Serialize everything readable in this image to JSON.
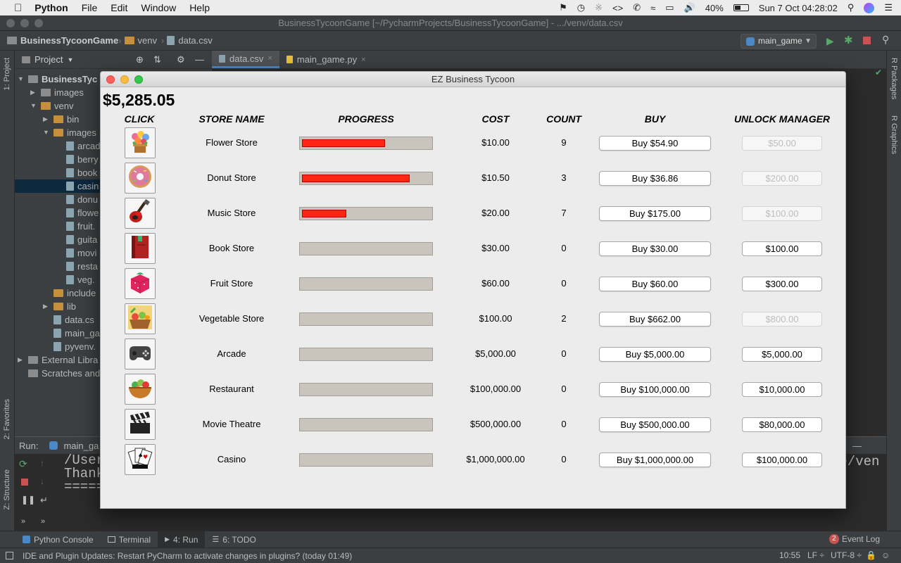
{
  "menubar": {
    "app": "Python",
    "items": [
      "File",
      "Edit",
      "Window",
      "Help"
    ],
    "battery": "40%",
    "clock": "Sun 7 Oct  04:28:02"
  },
  "ide": {
    "title": "BusinessTycoonGame [~/PycharmProjects/BusinessTycoonGame] - .../venv/data.csv",
    "breadcrumb": [
      "BusinessTycoonGame",
      "venv",
      "data.csv"
    ],
    "run_config": "main_game",
    "project_label": "Project",
    "tabs": [
      "data.csv",
      "main_game.py"
    ],
    "left_tools": [
      "1: Project",
      "2: Favorites",
      "Z: Structure"
    ],
    "right_tools": [
      "R Packages",
      "R Graphics"
    ],
    "tree": [
      {
        "label": "BusinessTyc",
        "indent": 0,
        "kind": "folder",
        "open": true,
        "bold": true
      },
      {
        "label": "images",
        "indent": 1,
        "kind": "folder",
        "open": false
      },
      {
        "label": "venv",
        "indent": 1,
        "kind": "folder-orange",
        "open": true
      },
      {
        "label": "bin",
        "indent": 2,
        "kind": "folder-orange",
        "open": false
      },
      {
        "label": "images",
        "indent": 2,
        "kind": "folder-orange",
        "open": true
      },
      {
        "label": "arcad",
        "indent": 3,
        "kind": "file"
      },
      {
        "label": "berry",
        "indent": 3,
        "kind": "file"
      },
      {
        "label": "book",
        "indent": 3,
        "kind": "file"
      },
      {
        "label": "casin",
        "indent": 3,
        "kind": "file",
        "selected": true
      },
      {
        "label": "donu",
        "indent": 3,
        "kind": "file"
      },
      {
        "label": "flowe",
        "indent": 3,
        "kind": "file"
      },
      {
        "label": "fruit.",
        "indent": 3,
        "kind": "file"
      },
      {
        "label": "guita",
        "indent": 3,
        "kind": "file"
      },
      {
        "label": "movi",
        "indent": 3,
        "kind": "file"
      },
      {
        "label": "resta",
        "indent": 3,
        "kind": "file"
      },
      {
        "label": "veg.",
        "indent": 3,
        "kind": "file"
      },
      {
        "label": "include",
        "indent": 2,
        "kind": "folder-orange",
        "open": false,
        "noarrow": true
      },
      {
        "label": "lib",
        "indent": 2,
        "kind": "folder-orange",
        "open": false
      },
      {
        "label": "data.cs",
        "indent": 2,
        "kind": "file"
      },
      {
        "label": "main_ga",
        "indent": 2,
        "kind": "file"
      },
      {
        "label": "pyvenv.",
        "indent": 2,
        "kind": "file"
      },
      {
        "label": "External Libra",
        "indent": 0,
        "kind": "folder",
        "open": false
      },
      {
        "label": "Scratches and",
        "indent": 0,
        "kind": "folder",
        "noarrow": true
      }
    ],
    "run": {
      "label": "Run:",
      "tab": "main_ga",
      "lines": [
        "/User",
        "Thank",
        "====="
      ],
      "right_fragment": "me/ven"
    },
    "bottom_tabs": [
      "Python Console",
      "Terminal",
      "4: Run",
      "6: TODO"
    ],
    "event_log": "Event Log",
    "event_count": "2",
    "status_message": "IDE and Plugin Updates: Restart PyCharm to activate changes in plugins? (today 01:49)",
    "cursor": "10:55",
    "line_sep": "LF ÷",
    "encoding": "UTF-8 ÷"
  },
  "game": {
    "window_title": "EZ Business Tycoon",
    "money": "$5,285.05",
    "headers": {
      "click": "CLICK",
      "store": "STORE NAME",
      "progress": "PROGRESS",
      "cost": "COST",
      "count": "COUNT",
      "buy": "BUY",
      "manager": "UNLOCK MANAGER"
    },
    "stores": [
      {
        "icon": "flower-pot-icon",
        "name": "Flower Store",
        "progress": 0.64,
        "cost": "$10.00",
        "count": "9",
        "buy": "Buy $54.90",
        "manager": "$50.00",
        "manager_enabled": false
      },
      {
        "icon": "donut-icon",
        "name": "Donut Store",
        "progress": 0.83,
        "cost": "$10.50",
        "count": "3",
        "buy": "Buy $36.86",
        "manager": "$200.00",
        "manager_enabled": false
      },
      {
        "icon": "guitar-icon",
        "name": "Music Store",
        "progress": 0.34,
        "cost": "$20.00",
        "count": "7",
        "buy": "Buy $175.00",
        "manager": "$100.00",
        "manager_enabled": false
      },
      {
        "icon": "book-icon",
        "name": "Book Store",
        "progress": 0,
        "cost": "$30.00",
        "count": "0",
        "buy": "Buy $30.00",
        "manager": "$100.00",
        "manager_enabled": true
      },
      {
        "icon": "berry-icon",
        "name": "Fruit Store",
        "progress": 0,
        "cost": "$60.00",
        "count": "0",
        "buy": "Buy $60.00",
        "manager": "$300.00",
        "manager_enabled": true
      },
      {
        "icon": "vegetable-basket-icon",
        "name": "Vegetable Store",
        "progress": 0,
        "cost": "$100.00",
        "count": "2",
        "buy": "Buy $662.00",
        "manager": "$800.00",
        "manager_enabled": false
      },
      {
        "icon": "gamepad-icon",
        "name": "Arcade",
        "progress": 0,
        "cost": "$5,000.00",
        "count": "0",
        "buy": "Buy $5,000.00",
        "manager": "$5,000.00",
        "manager_enabled": true
      },
      {
        "icon": "salad-bowl-icon",
        "name": "Restaurant",
        "progress": 0,
        "cost": "$100,000.00",
        "count": "0",
        "buy": "Buy $100,000.00",
        "manager": "$10,000.00",
        "manager_enabled": true
      },
      {
        "icon": "clapperboard-icon",
        "name": "Movie Theatre",
        "progress": 0,
        "cost": "$500,000.00",
        "count": "0",
        "buy": "Buy $500,000.00",
        "manager": "$80,000.00",
        "manager_enabled": true
      },
      {
        "icon": "playing-cards-icon",
        "name": "Casino",
        "progress": 0,
        "cost": "$1,000,000.00",
        "count": "0",
        "buy": "Buy $1,000,000.00",
        "manager": "$100,000.00",
        "manager_enabled": true
      }
    ]
  }
}
